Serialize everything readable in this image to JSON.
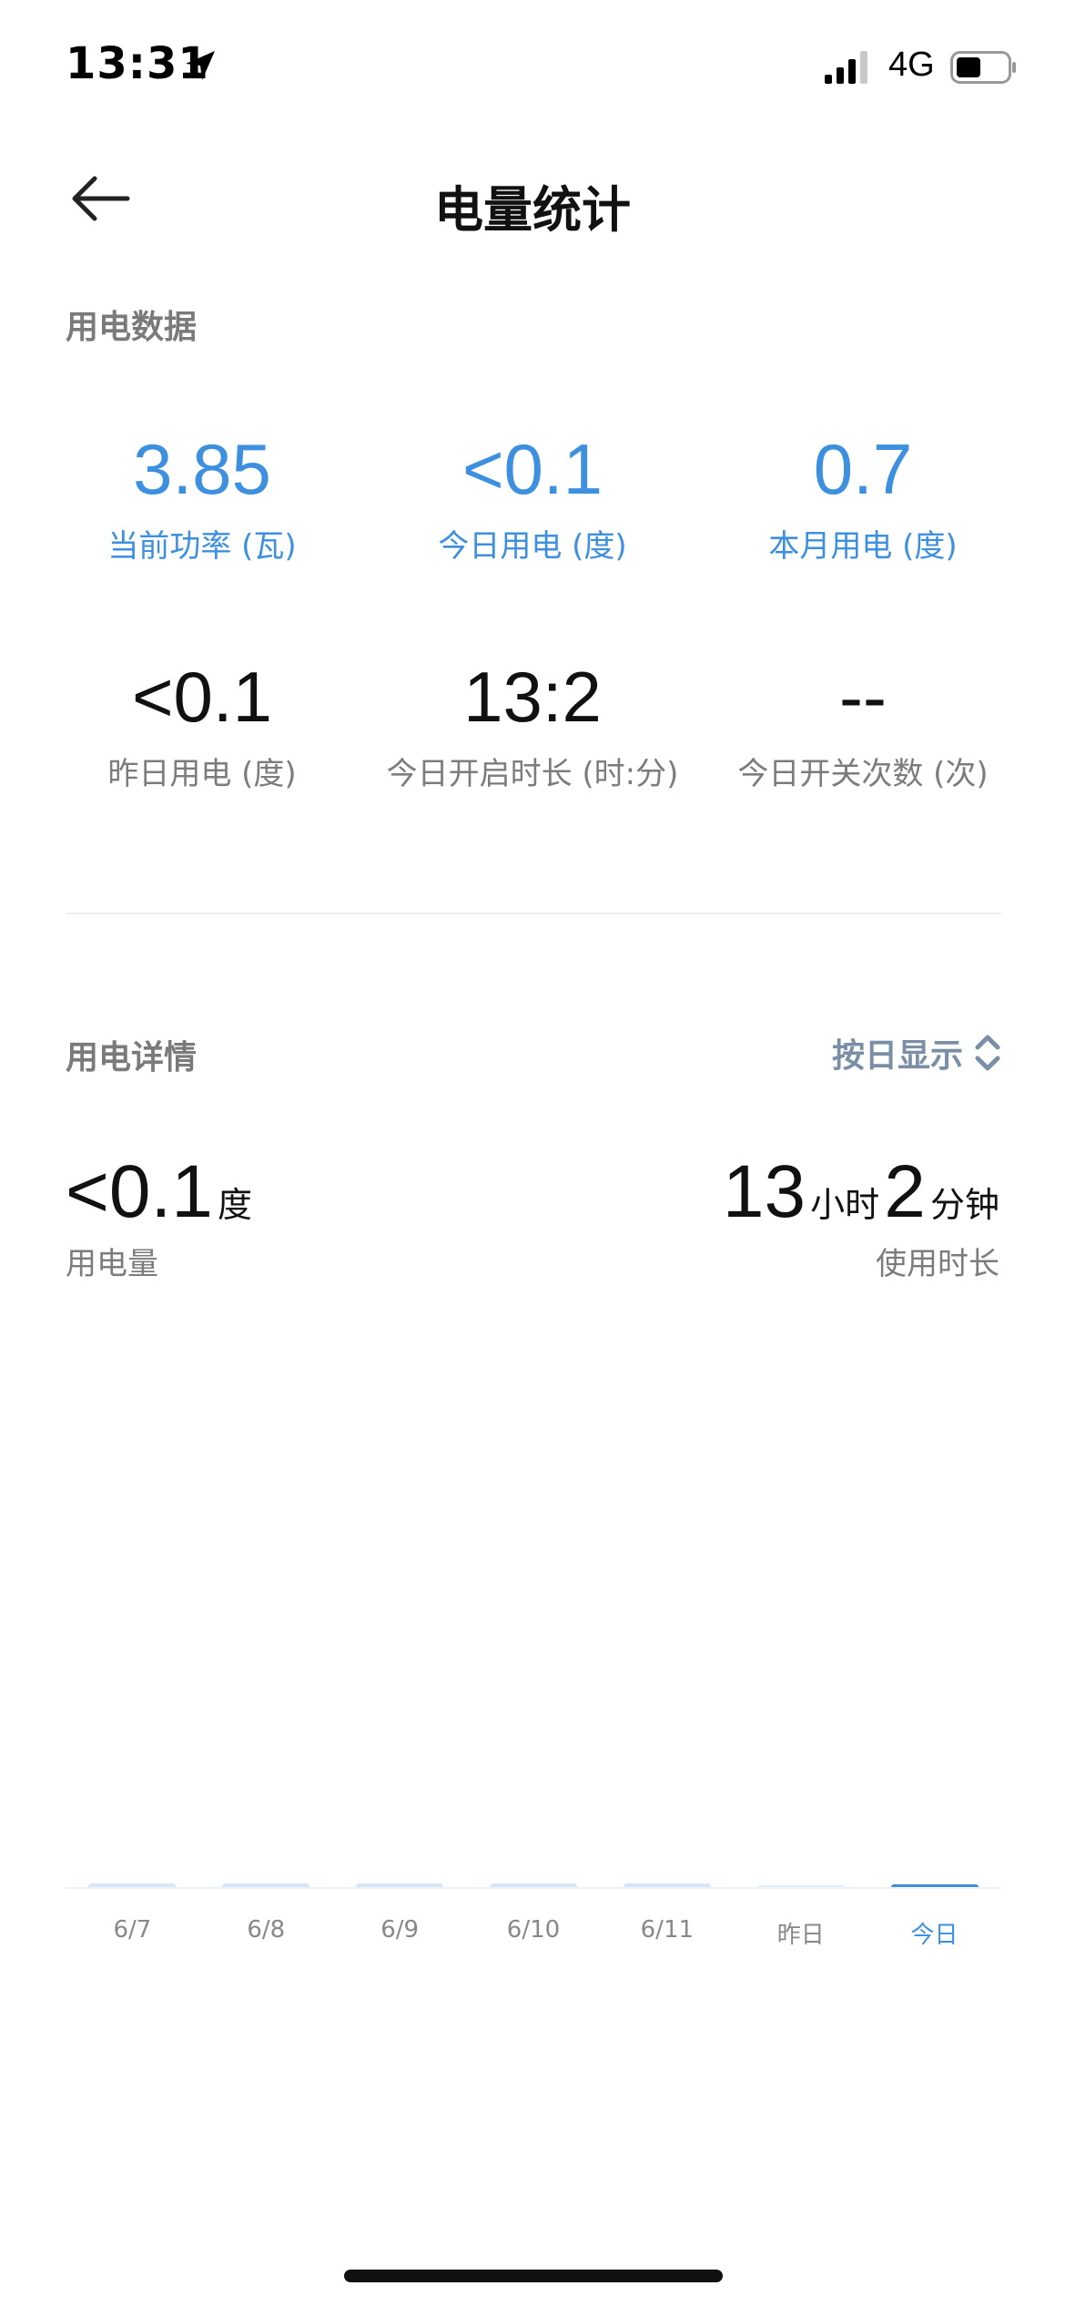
{
  "status_bar": {
    "time": "13:31",
    "network": "4G"
  },
  "header": {
    "title": "电量统计"
  },
  "usage_data": {
    "section_title": "用电数据",
    "stats": [
      {
        "value": "3.85",
        "label": "当前功率 (瓦)",
        "accent": true
      },
      {
        "value": "<0.1",
        "label": "今日用电 (度)",
        "accent": true
      },
      {
        "value": "0.7",
        "label": "本月用电 (度)",
        "accent": true
      },
      {
        "value": "<0.1",
        "label": "昨日用电 (度)",
        "accent": false
      },
      {
        "value": "13:2",
        "label": "今日开启时长 (时:分)",
        "accent": false
      },
      {
        "value": "--",
        "label": "今日开关次数 (次)",
        "accent": false
      }
    ]
  },
  "usage_detail": {
    "section_title": "用电详情",
    "mode_label": "按日显示",
    "energy": {
      "value": "<0.1",
      "unit": "度",
      "caption": "用电量"
    },
    "duration": {
      "hours": "13",
      "hours_unit": "小时",
      "minutes": "2",
      "minutes_unit": "分钟",
      "caption": "使用时长"
    }
  },
  "chart_data": {
    "type": "bar",
    "categories": [
      "6/7",
      "6/8",
      "6/9",
      "6/10",
      "6/11",
      "昨日",
      "今日"
    ],
    "values": [
      0.05,
      0.05,
      0.05,
      0.05,
      0.05,
      0.02,
      0.04
    ],
    "selected_index": 6,
    "xlabel": "",
    "ylabel": "",
    "grid": false
  },
  "colors": {
    "accent": "#3d8fdf",
    "bar_idle": "#d6e6f6",
    "bar_selected": "#3d8fdf",
    "bar_low": "#e4edf7"
  },
  "icons": {
    "location": "location-arrow-icon",
    "signal": "cellular-signal-icon",
    "battery": "battery-icon",
    "back": "back-arrow-icon",
    "sort": "up-down-chevron-icon"
  }
}
